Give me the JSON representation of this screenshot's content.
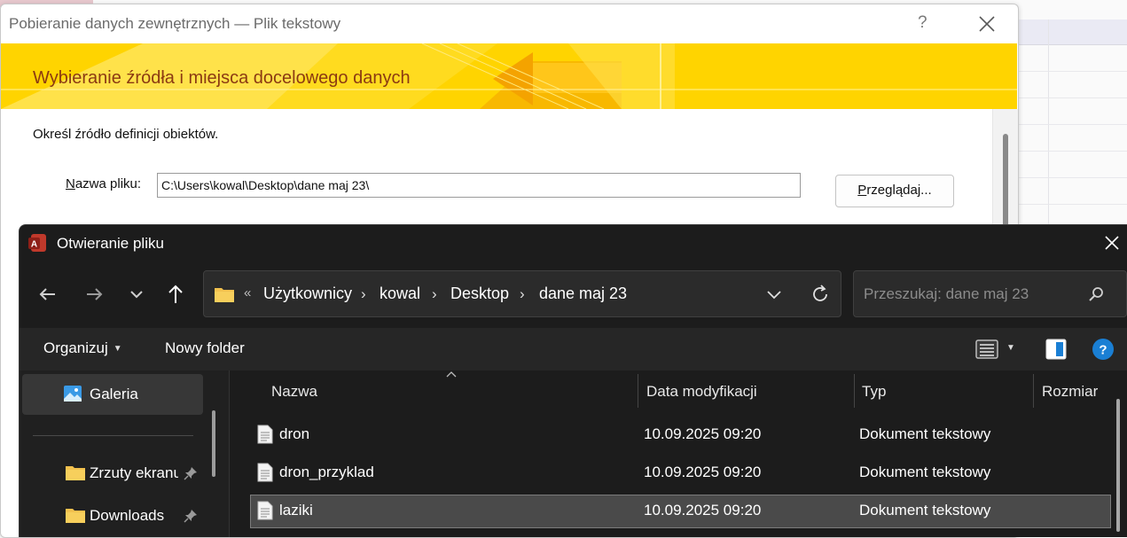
{
  "wizard": {
    "title": "Pobieranie danych zewnętrznych — Plik tekstowy",
    "help_label": "?",
    "heading": "Wybieranie źródła i miejsca docelowego danych",
    "instruction": "Określ źródło definicji obiektów.",
    "file_label_accesskey": "N",
    "file_label_rest": "azwa pliku:",
    "file_path": "C:\\Users\\kowal\\Desktop\\dane maj 23\\",
    "browse_accesskey": "P",
    "browse_rest": "rzeglądaj..."
  },
  "dialog": {
    "title": "Otwieranie pliku",
    "address": {
      "overflow": "«",
      "crumbs": [
        "Użytkownicy",
        "kowal",
        "Desktop",
        "dane maj 23"
      ],
      "separator": "›"
    },
    "search_placeholder": "Przeszukaj: dane maj 23",
    "toolbar": {
      "organize": "Organizuj",
      "new_folder": "Nowy folder"
    },
    "nav": {
      "gallery": "Galeria",
      "items": [
        "Zrzuty ekranu",
        "Downloads"
      ]
    },
    "columns": [
      "Nazwa",
      "Data modyfikacji",
      "Typ",
      "Rozmiar"
    ],
    "files": [
      {
        "name": "dron",
        "modified": "10.09.2025 09:20",
        "type": "Dokument tekstowy",
        "selected": false
      },
      {
        "name": "dron_przyklad",
        "modified": "10.09.2025 09:20",
        "type": "Dokument tekstowy",
        "selected": false
      },
      {
        "name": "laziki",
        "modified": "10.09.2025 09:20",
        "type": "Dokument tekstowy",
        "selected": true
      }
    ]
  },
  "colors": {
    "banner": "#ffd400",
    "banner_text": "#8b3a12",
    "dialog_bg": "#202020",
    "selection": "#4a4a4a",
    "accent_blue": "#1a7fd4",
    "folder": "#f2c14e"
  },
  "icons": [
    "access-app-icon",
    "close-icon",
    "back-arrow-icon",
    "forward-arrow-icon",
    "chevron-down-icon",
    "up-arrow-icon",
    "folder-icon",
    "refresh-icon",
    "search-icon",
    "details-view-icon",
    "preview-pane-icon",
    "help-icon",
    "gallery-icon",
    "pin-icon",
    "text-file-icon"
  ]
}
